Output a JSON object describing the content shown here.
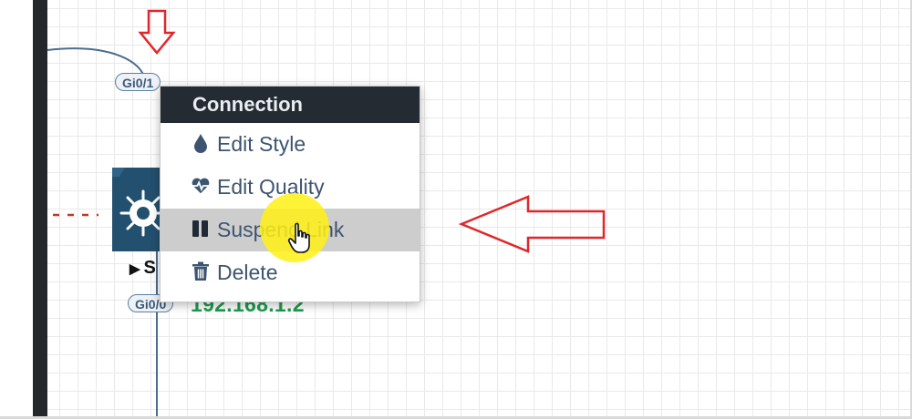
{
  "topology": {
    "port_top_label": "Gi0/1",
    "port_bottom_label": "Gi0/0",
    "device_name_visible": "S",
    "device_ip": "192.168.1.2"
  },
  "context_menu": {
    "title": "Connection",
    "items": [
      {
        "label": "Edit Style",
        "icon": "droplet-icon"
      },
      {
        "label": "Edit Quality",
        "icon": "heartbeat-icon"
      },
      {
        "label": "Suspend Link",
        "icon": "pause-icon",
        "active": true
      },
      {
        "label": "Delete",
        "icon": "trash-icon"
      }
    ]
  },
  "annotations": {
    "arrow_color": "#e0262b",
    "highlight_color": "#fff014"
  },
  "colors": {
    "sidebar": "#25282b",
    "menu_header": "#242b32",
    "menu_text": "#3d5470",
    "ip_text": "#1e9b4e",
    "device_blue": "#23506e",
    "link_line": "#4c6e8e"
  }
}
